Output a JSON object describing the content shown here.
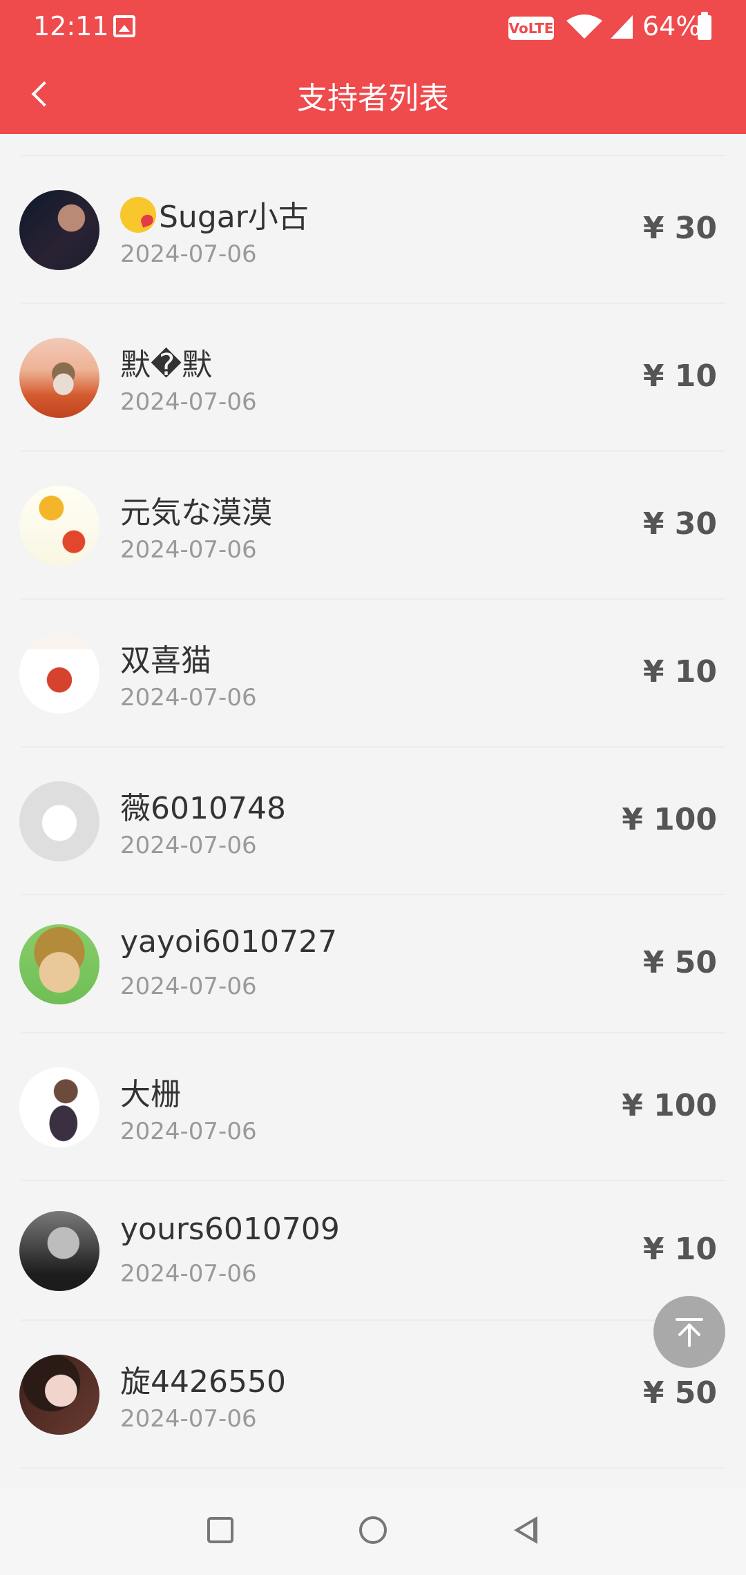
{
  "status_bar": {
    "time": "12:11",
    "network_badge": "VoLTE",
    "battery_percent": "64%"
  },
  "nav": {
    "title": "支持者列表"
  },
  "supporters": [
    {
      "name": "Sugar小古",
      "date": "2024-07-06",
      "amount": "¥ 30"
    },
    {
      "name": "默�默",
      "date": "2024-07-06",
      "amount": "¥ 10"
    },
    {
      "name": "元気な漠漠",
      "date": "2024-07-06",
      "amount": "¥ 30"
    },
    {
      "name": "双喜猫",
      "date": "2024-07-06",
      "amount": "¥ 10"
    },
    {
      "name": "薇6010748",
      "date": "2024-07-06",
      "amount": "¥ 100"
    },
    {
      "name": "yayoi6010727",
      "date": "2024-07-06",
      "amount": "¥ 50"
    },
    {
      "name": "大栅",
      "date": "2024-07-06",
      "amount": "¥ 100"
    },
    {
      "name": "yours6010709",
      "date": "2024-07-06",
      "amount": "¥ 10"
    },
    {
      "name": "旋4426550",
      "date": "2024-07-06",
      "amount": "¥ 50"
    }
  ],
  "icons": {
    "back": "chevron-left-icon",
    "scroll_top": "arrow-up-to-top-icon",
    "recent_apps": "square-icon",
    "home": "circle-icon",
    "system_back": "triangle-back-icon"
  },
  "colors": {
    "header": "#ef4a4c",
    "amount": "#555555",
    "date": "#999999"
  }
}
